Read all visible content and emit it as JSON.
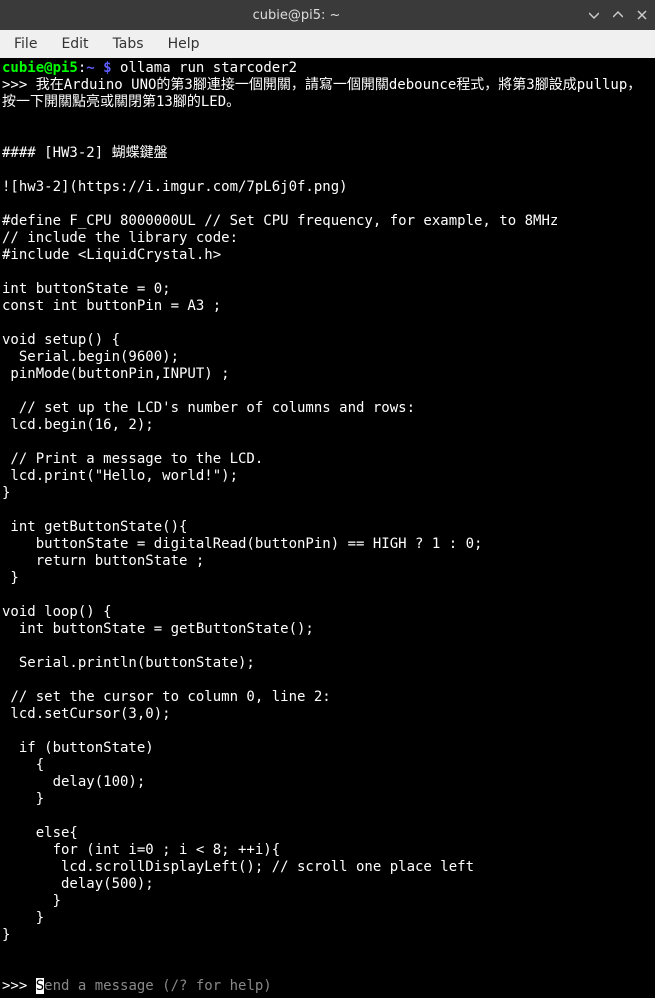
{
  "window": {
    "title": "cubie@pi5: ~"
  },
  "menubar": {
    "file": "File",
    "edit": "Edit",
    "tabs": "Tabs",
    "help": "Help"
  },
  "terminal": {
    "prompt_user": "cubie@pi5",
    "prompt_sep": ":",
    "prompt_path": "~",
    "prompt_sym": "$",
    "command": "ollama run starcoder2",
    "repl_prefix": ">>> ",
    "user_message": "我在Arduino UNO的第3腳連接一個開關，請寫一個開關debounce程式，將第3腳設成pullup，按一下開關點亮或關閉第13腳的LED。",
    "output_lines": [
      "",
      "",
      "#### [HW3-2] 蝴蝶鍵盤",
      "",
      "![hw3-2](https://i.imgur.com/7pL6j0f.png)",
      "",
      "#define F_CPU 8000000UL // Set CPU frequency, for example, to 8MHz",
      "// include the library code:",
      "#include <LiquidCrystal.h>",
      "",
      "int buttonState = 0;",
      "const int buttonPin = A3 ;",
      "",
      "void setup() {",
      "  Serial.begin(9600);",
      " pinMode(buttonPin,INPUT) ;",
      "",
      "  // set up the LCD's number of columns and rows:",
      " lcd.begin(16, 2);",
      "",
      " // Print a message to the LCD.",
      " lcd.print(\"Hello, world!\");",
      "}",
      "",
      " int getButtonState(){",
      "    buttonState = digitalRead(buttonPin) == HIGH ? 1 : 0;",
      "    return buttonState ;",
      " }",
      "",
      "void loop() {",
      "  int buttonState = getButtonState();",
      "",
      "  Serial.println(buttonState);",
      "",
      " // set the cursor to column 0, line 2:",
      " lcd.setCursor(3,0);",
      "",
      "  if (buttonState)",
      "    {",
      "      delay(100);",
      "    }",
      "",
      "    else{",
      "      for (int i=0 ; i < 8; ++i){",
      "       lcd.scrollDisplayLeft(); // scroll one place left",
      "       delay(500);",
      "      }",
      "    }",
      "}",
      "",
      ""
    ],
    "input_prompt": ">>> ",
    "input_placeholder_first_char": "S",
    "input_placeholder_rest": "end a message (/? for help)"
  }
}
